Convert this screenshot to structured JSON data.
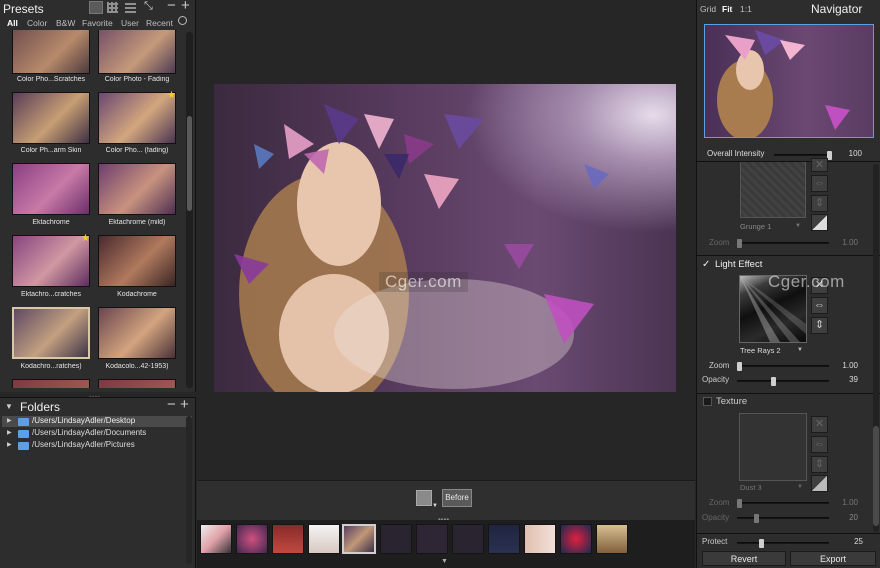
{
  "presets": {
    "title": "Presets",
    "filters": [
      "All",
      "Color",
      "B&W",
      "Favorite",
      "User",
      "Recent"
    ],
    "items": [
      {
        "label": "Color Pho...Scratches"
      },
      {
        "label": "Color Photo - Fading"
      },
      {
        "label": "Color Ph...arm Skin"
      },
      {
        "label": "Color Pho... (fading)"
      },
      {
        "label": "Ektachrome"
      },
      {
        "label": "Ektachrome (mild)"
      },
      {
        "label": "Ektachro...cratches"
      },
      {
        "label": "Kodachrome"
      },
      {
        "label": "Kodachro...ratches)"
      },
      {
        "label": "Kodacolo...42-1953)"
      }
    ]
  },
  "folders": {
    "title": "Folders",
    "items": [
      "/Users/LindsayAdler/Desktop",
      "/Users/LindsayAdler/Documents",
      "/Users/LindsayAdler/Pictures"
    ]
  },
  "canvas": {
    "before_label": "Before",
    "watermark": "Cger.com"
  },
  "navigator": {
    "title": "Navigator",
    "view_modes": [
      "Grid",
      "Fit",
      "1:1"
    ],
    "overall_label": "Overall Intensity",
    "overall_value": "100",
    "overall_fraction": 1.0
  },
  "layers": {
    "grunge": {
      "name": "Grunge 1",
      "zoom_label": "Zoom",
      "zoom_value": "1.00",
      "zoom_fraction": 0.0
    },
    "light": {
      "title": "Light Effect",
      "checked": true,
      "name": "Tree Rays 2",
      "zoom_label": "Zoom",
      "zoom_value": "1.00",
      "zoom_fraction": 0.0,
      "opacity_label": "Opacity",
      "opacity_value": "39",
      "opacity_fraction": 0.39
    },
    "texture": {
      "title": "Texture",
      "checked": false,
      "name": "Dust 3",
      "zoom_label": "Zoom",
      "zoom_value": "1.00",
      "zoom_fraction": 0.0,
      "opacity_label": "Opacity",
      "opacity_value": "20",
      "opacity_fraction": 0.2
    },
    "watermark": "Cger.com"
  },
  "footer": {
    "protect_label": "Protect",
    "protect_value": "25",
    "protect_fraction": 0.25,
    "revert_label": "Revert",
    "export_label": "Export"
  },
  "colors": {
    "accent": "#5aa0e6",
    "panel": "#2d2d2d",
    "background": "#262626",
    "selection": "#4a4a4a"
  }
}
